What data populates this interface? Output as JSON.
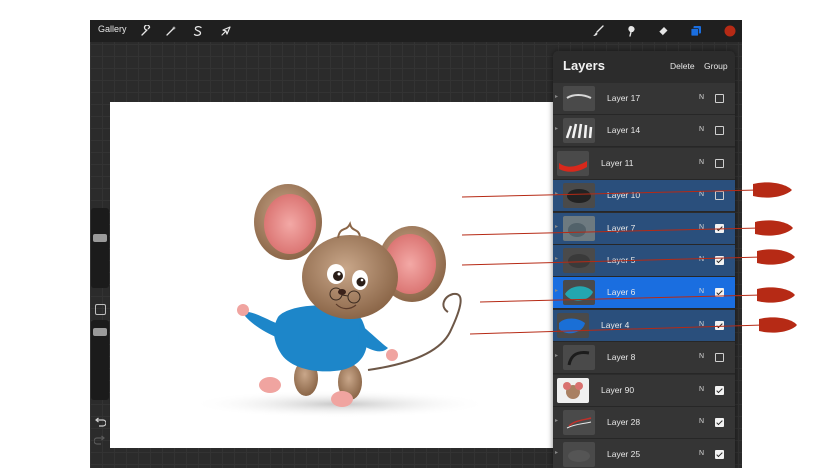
{
  "toolbar": {
    "gallery_label": "Gallery",
    "left_tools": [
      "wrench-icon",
      "magic-wand-icon",
      "selection-s-icon",
      "arrow-cursor-icon"
    ],
    "right_tools": [
      "brush-icon",
      "smudge-icon",
      "eraser-icon",
      "layers-icon"
    ],
    "current_color": "#b62a15"
  },
  "layers_panel": {
    "title": "Layers",
    "delete_label": "Delete",
    "group_label": "Group",
    "layers": [
      {
        "name": "Layer 17",
        "blend": "N",
        "visible": false,
        "state": "normal",
        "has_clip_chevron": true
      },
      {
        "name": "Layer 14",
        "blend": "N",
        "visible": false,
        "state": "normal",
        "has_clip_chevron": true
      },
      {
        "name": "Layer 11",
        "blend": "N",
        "visible": false,
        "state": "normal",
        "has_clip_chevron": false
      },
      {
        "name": "Layer 10",
        "blend": "N",
        "visible": false,
        "state": "selected",
        "has_clip_chevron": true
      },
      {
        "name": "Layer 7",
        "blend": "N",
        "visible": true,
        "state": "selected",
        "has_clip_chevron": true
      },
      {
        "name": "Layer 5",
        "blend": "N",
        "visible": true,
        "state": "selected",
        "has_clip_chevron": true
      },
      {
        "name": "Layer 6",
        "blend": "N",
        "visible": true,
        "state": "active",
        "has_clip_chevron": true
      },
      {
        "name": "Layer 4",
        "blend": "N",
        "visible": true,
        "state": "selected",
        "has_clip_chevron": false
      },
      {
        "name": "Layer 8",
        "blend": "N",
        "visible": false,
        "state": "normal",
        "has_clip_chevron": true
      },
      {
        "name": "Layer 90",
        "blend": "N",
        "visible": true,
        "state": "normal",
        "has_clip_chevron": false
      },
      {
        "name": "Layer 28",
        "blend": "N",
        "visible": true,
        "state": "normal",
        "has_clip_chevron": true
      },
      {
        "name": "Layer 25",
        "blend": "N",
        "visible": true,
        "state": "normal",
        "has_clip_chevron": true
      }
    ]
  },
  "sidebar": {
    "undo_icon": "undo-icon",
    "redo_icon": "redo-icon",
    "modify_button_icon": "square-icon"
  },
  "colors": {
    "accent_blue": "#1a6ee0",
    "selected_blue": "#2a4f7c",
    "annotation_red": "#b62a15"
  }
}
